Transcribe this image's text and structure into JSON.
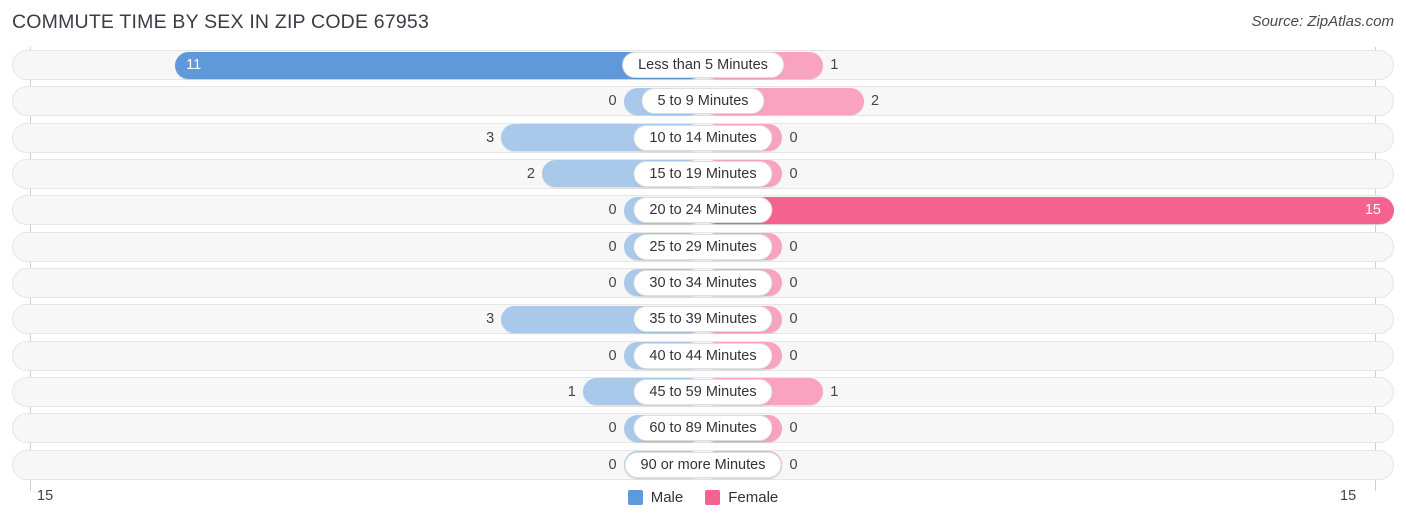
{
  "header": {
    "title": "COMMUTE TIME BY SEX IN ZIP CODE 67953",
    "source": "Source: ZipAtlas.com"
  },
  "colors": {
    "male_max": "#5f99da",
    "male_light": "#a9c9ea",
    "female_max": "#f4628f",
    "female_light": "#f9a3c0",
    "track_fill": "#f7f7f7",
    "track_border": "#e6e6e6",
    "axis": "#cfcfcf",
    "text": "#43434a"
  },
  "axis": {
    "left_label": "15",
    "right_label": "15",
    "max": 15
  },
  "legend": [
    {
      "label": "Male",
      "color": "#5f99da",
      "icon": "square-swatch"
    },
    {
      "label": "Female",
      "color": "#f4628f",
      "icon": "square-swatch"
    }
  ],
  "chart_data": {
    "type": "bar",
    "orientation": "horizontal-diverging",
    "title": "COMMUTE TIME BY SEX IN ZIP CODE 67953",
    "xlabel": "",
    "ylabel": "",
    "grid": false,
    "legend_position": "bottom-center",
    "axis_max": 15,
    "axis_labels": [
      "15",
      "15"
    ],
    "categories": [
      "Less than 5 Minutes",
      "5 to 9 Minutes",
      "10 to 14 Minutes",
      "15 to 19 Minutes",
      "20 to 24 Minutes",
      "25 to 29 Minutes",
      "30 to 34 Minutes",
      "35 to 39 Minutes",
      "40 to 44 Minutes",
      "45 to 59 Minutes",
      "60 to 89 Minutes",
      "90 or more Minutes"
    ],
    "series": [
      {
        "name": "Male",
        "values": [
          11,
          0,
          3,
          2,
          0,
          0,
          0,
          3,
          0,
          1,
          0,
          0
        ]
      },
      {
        "name": "Female",
        "values": [
          1,
          2,
          0,
          0,
          15,
          0,
          0,
          0,
          0,
          1,
          0,
          0
        ]
      }
    ]
  },
  "rows": [
    {
      "category": "Less than 5 Minutes",
      "male": "11",
      "female": "1"
    },
    {
      "category": "5 to 9 Minutes",
      "male": "0",
      "female": "2"
    },
    {
      "category": "10 to 14 Minutes",
      "male": "3",
      "female": "0"
    },
    {
      "category": "15 to 19 Minutes",
      "male": "2",
      "female": "0"
    },
    {
      "category": "20 to 24 Minutes",
      "male": "0",
      "female": "15"
    },
    {
      "category": "25 to 29 Minutes",
      "male": "0",
      "female": "0"
    },
    {
      "category": "30 to 34 Minutes",
      "male": "0",
      "female": "0"
    },
    {
      "category": "35 to 39 Minutes",
      "male": "3",
      "female": "0"
    },
    {
      "category": "40 to 44 Minutes",
      "male": "0",
      "female": "0"
    },
    {
      "category": "45 to 59 Minutes",
      "male": "1",
      "female": "1"
    },
    {
      "category": "60 to 89 Minutes",
      "male": "0",
      "female": "0"
    },
    {
      "category": "90 or more Minutes",
      "male": "0",
      "female": "0"
    }
  ]
}
